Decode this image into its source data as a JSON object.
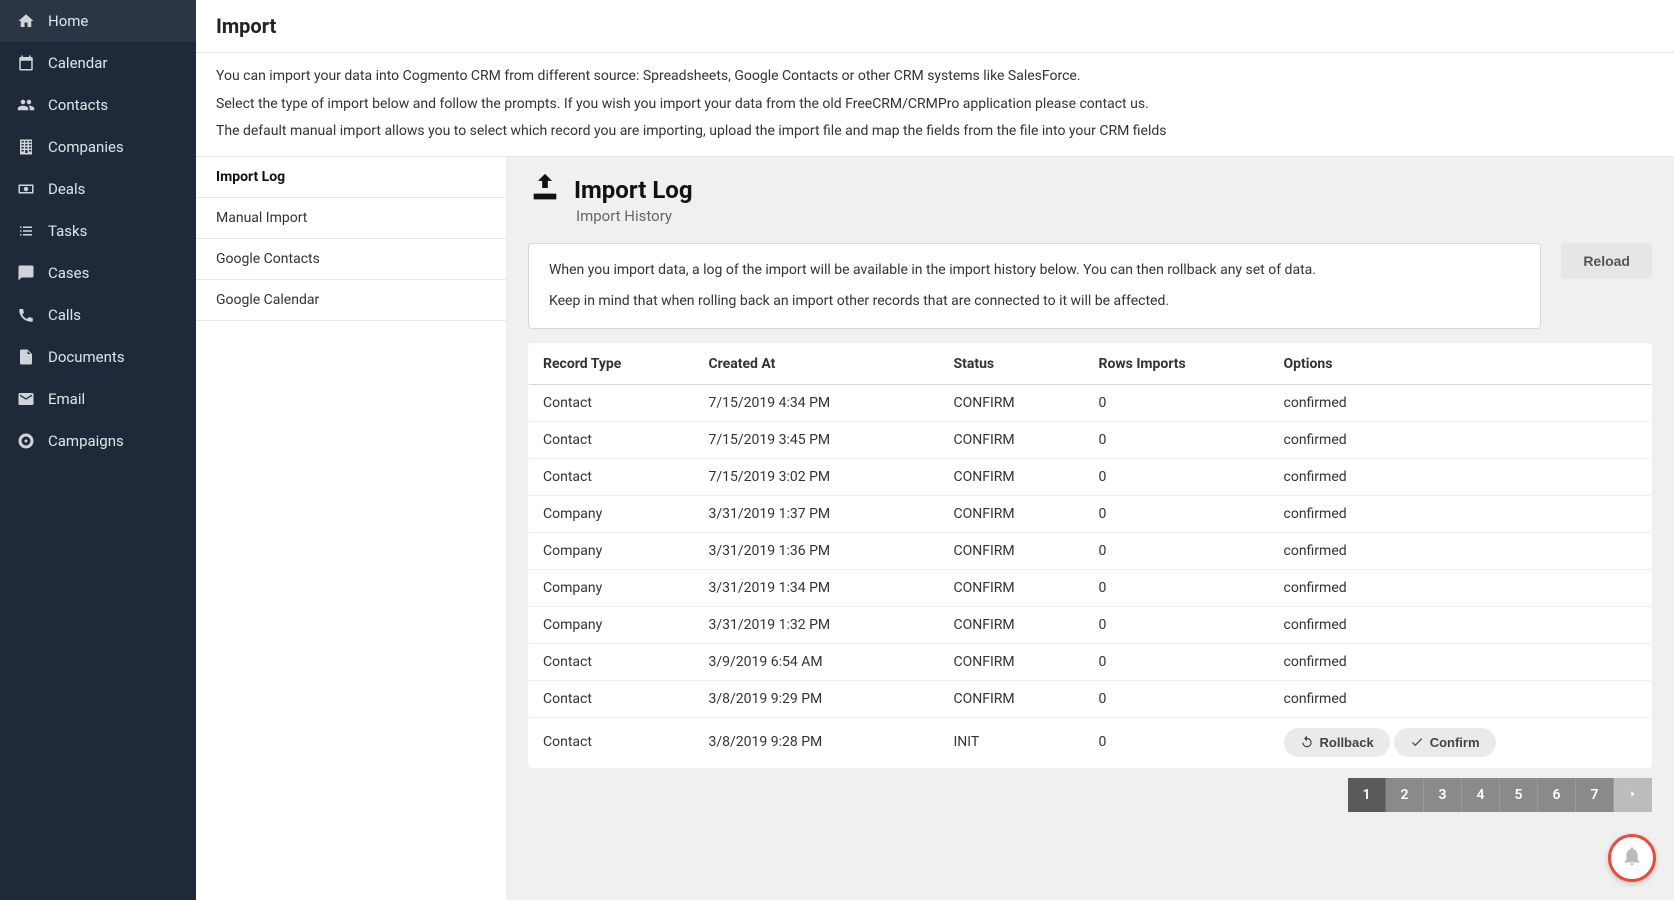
{
  "sidebar": {
    "items": [
      {
        "label": "Home",
        "name": "sidebar-item-home",
        "icon": "home"
      },
      {
        "label": "Calendar",
        "name": "sidebar-item-calendar",
        "icon": "calendar"
      },
      {
        "label": "Contacts",
        "name": "sidebar-item-contacts",
        "icon": "users"
      },
      {
        "label": "Companies",
        "name": "sidebar-item-companies",
        "icon": "building"
      },
      {
        "label": "Deals",
        "name": "sidebar-item-deals",
        "icon": "money"
      },
      {
        "label": "Tasks",
        "name": "sidebar-item-tasks",
        "icon": "list"
      },
      {
        "label": "Cases",
        "name": "sidebar-item-cases",
        "icon": "chat"
      },
      {
        "label": "Calls",
        "name": "sidebar-item-calls",
        "icon": "phone"
      },
      {
        "label": "Documents",
        "name": "sidebar-item-documents",
        "icon": "doc"
      },
      {
        "label": "Email",
        "name": "sidebar-item-email",
        "icon": "mail"
      },
      {
        "label": "Campaigns",
        "name": "sidebar-item-campaigns",
        "icon": "target"
      }
    ]
  },
  "page": {
    "title": "Import",
    "intro": [
      "You can import your data into Cogmento CRM from different source: Spreadsheets, Google Contacts or other CRM systems like SalesForce.",
      "Select the type of import below and follow the prompts. If you wish you import your data from the old FreeCRM/CRMPro application please contact us.",
      "The default manual import allows you to select which record you are importing, upload the import file and map the fields from the file into your CRM fields"
    ]
  },
  "subnav": {
    "items": [
      {
        "label": "Import Log",
        "active": true
      },
      {
        "label": "Manual Import",
        "active": false
      },
      {
        "label": "Google Contacts",
        "active": false
      },
      {
        "label": "Google Calendar",
        "active": false
      }
    ]
  },
  "panel": {
    "title": "Import Log",
    "subtitle": "Import History",
    "info": [
      "When you import data, a log of the import will be available in the import history below. You can then rollback any set of data.",
      "Keep in mind that when rolling back an import other records that are connected to it will be affected."
    ],
    "reload_label": "Reload",
    "table": {
      "headers": [
        "Record Type",
        "Created At",
        "Status",
        "Rows Imports",
        "Options"
      ],
      "rows": [
        {
          "type": "Contact",
          "created": "7/15/2019 4:34 PM",
          "status": "CONFIRM",
          "rows": "0",
          "options": "confirmed"
        },
        {
          "type": "Contact",
          "created": "7/15/2019 3:45 PM",
          "status": "CONFIRM",
          "rows": "0",
          "options": "confirmed"
        },
        {
          "type": "Contact",
          "created": "7/15/2019 3:02 PM",
          "status": "CONFIRM",
          "rows": "0",
          "options": "confirmed"
        },
        {
          "type": "Company",
          "created": "3/31/2019 1:37 PM",
          "status": "CONFIRM",
          "rows": "0",
          "options": "confirmed"
        },
        {
          "type": "Company",
          "created": "3/31/2019 1:36 PM",
          "status": "CONFIRM",
          "rows": "0",
          "options": "confirmed"
        },
        {
          "type": "Company",
          "created": "3/31/2019 1:34 PM",
          "status": "CONFIRM",
          "rows": "0",
          "options": "confirmed"
        },
        {
          "type": "Company",
          "created": "3/31/2019 1:32 PM",
          "status": "CONFIRM",
          "rows": "0",
          "options": "confirmed"
        },
        {
          "type": "Contact",
          "created": "3/9/2019 6:54 AM",
          "status": "CONFIRM",
          "rows": "0",
          "options": "confirmed"
        },
        {
          "type": "Contact",
          "created": "3/8/2019 9:29 PM",
          "status": "CONFIRM",
          "rows": "0",
          "options": "confirmed"
        },
        {
          "type": "Contact",
          "created": "3/8/2019 9:28 PM",
          "status": "INIT",
          "rows": "0",
          "options": "actions"
        }
      ]
    },
    "actions": {
      "rollback": "Rollback",
      "confirm": "Confirm"
    }
  },
  "pagination": {
    "pages": [
      "1",
      "2",
      "3",
      "4",
      "5",
      "6",
      "7"
    ],
    "active": "1",
    "next_label": "▶"
  }
}
